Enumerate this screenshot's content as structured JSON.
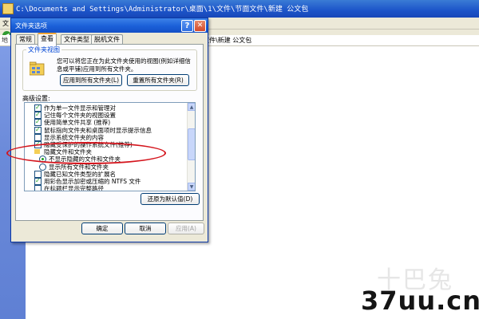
{
  "explorer": {
    "title": "C:\\Documents and Settings\\Administrator\\桌面\\1\\文件\\节面文件\\新建 公文包",
    "menu_fragment": "文",
    "address_label": "地",
    "address_path": "文件\\新建 公文包"
  },
  "dialog": {
    "title": "文件夹选项",
    "help": "?",
    "close": "✕",
    "tabs": [
      "常规",
      "查看",
      "文件类型",
      "脱机文件"
    ],
    "folder_views": {
      "label": "文件夹视图",
      "desc_line1": "您可以将您正在为此文件夹使用的视图(例如详细信",
      "desc_line2": "息或平铺)应用到所有文件夹。",
      "apply_all": "应用到所有文件夹(L)",
      "reset_all": "重置所有文件夹(R)"
    },
    "advanced_label": "高级设置:",
    "advanced_items": [
      {
        "text": "作为单一文件显示和管理对",
        "type": "check",
        "checked": true
      },
      {
        "text": "记住每个文件夹的视图设置",
        "type": "check",
        "checked": true
      },
      {
        "text": "使用简单文件共享 (推荐)",
        "type": "check",
        "checked": true
      },
      {
        "text": "鼠标指向文件夹和桌面项时显示提示信息",
        "type": "check",
        "checked": true
      },
      {
        "text": "显示系统文件夹的内容",
        "type": "check",
        "checked": false
      },
      {
        "text": "隐藏受保护的操作系统文件(推荐)",
        "type": "check",
        "checked": true
      },
      {
        "text": "隐藏文件和文件夹",
        "type": "folder",
        "checked": false
      },
      {
        "text": "不显示隐藏的文件和文件夹",
        "type": "radio",
        "checked": true
      },
      {
        "text": "显示所有文件和文件夹",
        "type": "radio",
        "checked": false
      },
      {
        "text": "隐藏已知文件类型的扩展名",
        "type": "check",
        "checked": false
      },
      {
        "text": "用彩色显示加密或压缩的 NTFS 文件",
        "type": "check",
        "checked": true
      },
      {
        "text": "在标题栏显示完整路径",
        "type": "check",
        "checked": false
      }
    ],
    "restore_defaults": "还原为默认值(D)",
    "ok": "确定",
    "cancel": "取消",
    "apply": "应用(A)"
  },
  "watermark": {
    "cn": "十巴兔",
    "site": "37uu.cn"
  },
  "colors": {
    "annotation": "#d4141c",
    "title_blue": "#1a5fd8",
    "accent_tab": "#f1a636"
  }
}
